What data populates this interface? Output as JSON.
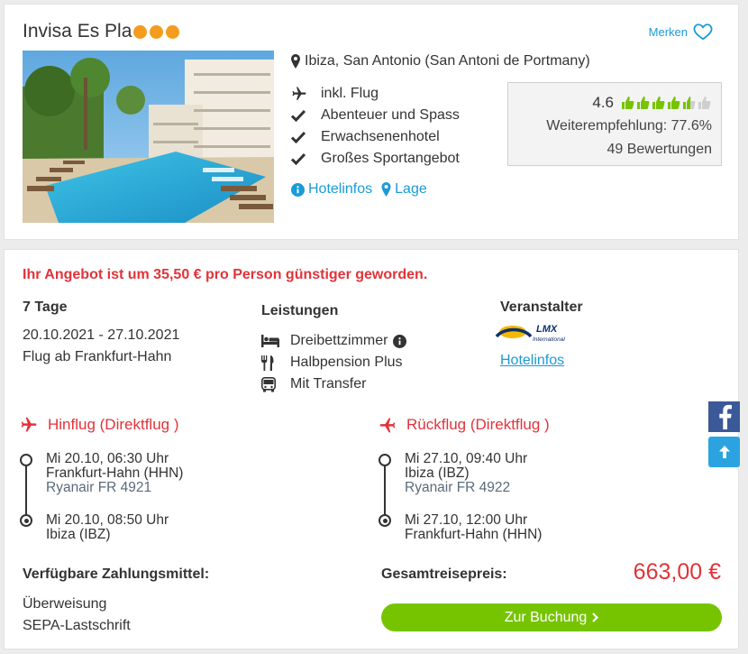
{
  "hotel": {
    "name": "Invisa Es Pla",
    "merken_label": "Merken",
    "location": "Ibiza, San Antonio (San Antoni de Portmany)",
    "features": [
      {
        "icon": "plane-icon",
        "label": "inkl. Flug"
      },
      {
        "icon": "check-icon",
        "label": "Abenteuer und Spass"
      },
      {
        "icon": "check-icon",
        "label": "Erwachsenenhotel"
      },
      {
        "icon": "check-icon",
        "label": "Großes Sportangebot"
      }
    ],
    "hotelinfos_link": "Hotelinfos",
    "lage_link": "Lage",
    "rating": {
      "score": "4.6",
      "recommendation": "Weiterempfehlung: 77.6%",
      "reviews": "49 Bewertungen"
    },
    "stars_count": 3,
    "star_color": "#f39c1e"
  },
  "offer": {
    "price_alert": "Ihr Angebot ist um 35,50 € pro Person günstiger geworden.",
    "duration": "7 Tage",
    "date_range": "20.10.2021 - 27.10.2021",
    "departure": "Flug ab Frankfurt-Hahn",
    "leistungen_heading": "Leistungen",
    "leistungen": [
      {
        "icon": "bed-icon",
        "label": "Dreibettzimmer"
      },
      {
        "icon": "cutlery-icon",
        "label": "Halbpension Plus"
      },
      {
        "icon": "bus-icon",
        "label": "Mit Transfer"
      }
    ],
    "veranstalter_heading": "Veranstalter",
    "veranstalter_logo_text": "LMX",
    "veranstalter_logo_sub": "International",
    "veranstalter_link": "Hotelinfos"
  },
  "flights": {
    "outbound": {
      "title": "Hinflug (Direktflug )",
      "dep_time": "Mi 20.10, 06:30 Uhr",
      "dep_airport": "Frankfurt-Hahn (HHN)",
      "carrier": "Ryanair FR 4921",
      "arr_time": "Mi 20.10, 08:50 Uhr",
      "arr_airport": "Ibiza (IBZ)"
    },
    "return": {
      "title": "Rückflug (Direktflug )",
      "dep_time": "Mi 27.10, 09:40 Uhr",
      "dep_airport": "Ibiza (IBZ)",
      "carrier": "Ryanair FR 4922",
      "arr_time": "Mi 27.10, 12:00 Uhr",
      "arr_airport": "Frankfurt-Hahn (HHN)"
    }
  },
  "payment": {
    "heading": "Verfügbare Zahlungsmittel:",
    "methods": [
      "Überweisung",
      "SEPA-Lastschrift"
    ]
  },
  "total": {
    "label": "Gesamtreisepreis:",
    "price": "663,00 €"
  },
  "booking_button": "Zur Buchung",
  "colors": {
    "accent_blue": "#1a9bd7",
    "alert_red": "#e23339",
    "button_green": "#76c400",
    "thumb_green": "#76c400",
    "facebook_blue": "#3b5998"
  }
}
